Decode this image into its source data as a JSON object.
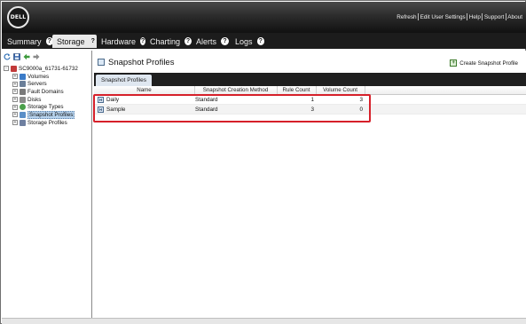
{
  "header": {
    "logo_text": "DELL",
    "links": [
      "Refresh",
      "Edit User Settings",
      "Help",
      "Support",
      "About"
    ]
  },
  "tabs": [
    {
      "label": "Summary",
      "help": "?",
      "active": false
    },
    {
      "label": "Storage",
      "help": "?",
      "active": true
    },
    {
      "label": "Hardware",
      "help": "?",
      "active": false
    },
    {
      "label": "Charting",
      "help": "?",
      "active": false
    },
    {
      "label": "Alerts",
      "help": "?",
      "active": false
    },
    {
      "label": "Logs",
      "help": "?",
      "active": false
    }
  ],
  "left_toolbar": {
    "icons": [
      "refresh-icon",
      "save-icon",
      "back-arrow-icon",
      "forward-arrow-icon"
    ]
  },
  "tree": {
    "root": {
      "label": "SC9000a_61731-61732",
      "expander": "-"
    },
    "items": [
      {
        "label": "Volumes",
        "expander": "+",
        "icon": "volumes-icon",
        "color": "#3b7bc8"
      },
      {
        "label": "Servers",
        "expander": "+",
        "icon": "servers-icon",
        "color": "#6b7f99"
      },
      {
        "label": "Fault Domains",
        "expander": "+",
        "icon": "fault-domains-icon",
        "color": "#7a7a7a"
      },
      {
        "label": "Disks",
        "expander": "+",
        "icon": "disks-icon",
        "color": "#8b8b8b"
      },
      {
        "label": "Storage Types",
        "expander": "+",
        "icon": "storage-types-icon",
        "color": "#4aa04a"
      },
      {
        "label": "Snapshot Profiles",
        "expander": "+",
        "icon": "snapshot-profiles-icon",
        "color": "#5a8fc8",
        "selected": true
      },
      {
        "label": "Storage Profiles",
        "expander": "+",
        "icon": "storage-profiles-icon",
        "color": "#6e7fa0"
      }
    ]
  },
  "page": {
    "title": "Snapshot Profiles",
    "create_button": "Create Snapshot Profile",
    "subtab": "Snapshot Profiles"
  },
  "table": {
    "columns": [
      "Name",
      "Snapshot Creation Method",
      "Rule Count",
      "Volume Count"
    ],
    "rows": [
      {
        "name": "Daily",
        "method": "Standard",
        "rule_count": "1",
        "volume_count": "3"
      },
      {
        "name": "Sample",
        "method": "Standard",
        "rule_count": "3",
        "volume_count": "0"
      }
    ]
  },
  "colors": {
    "highlight": "#d6202a",
    "header_dark": "#1c1c1c",
    "selection": "#b7d3ee"
  }
}
